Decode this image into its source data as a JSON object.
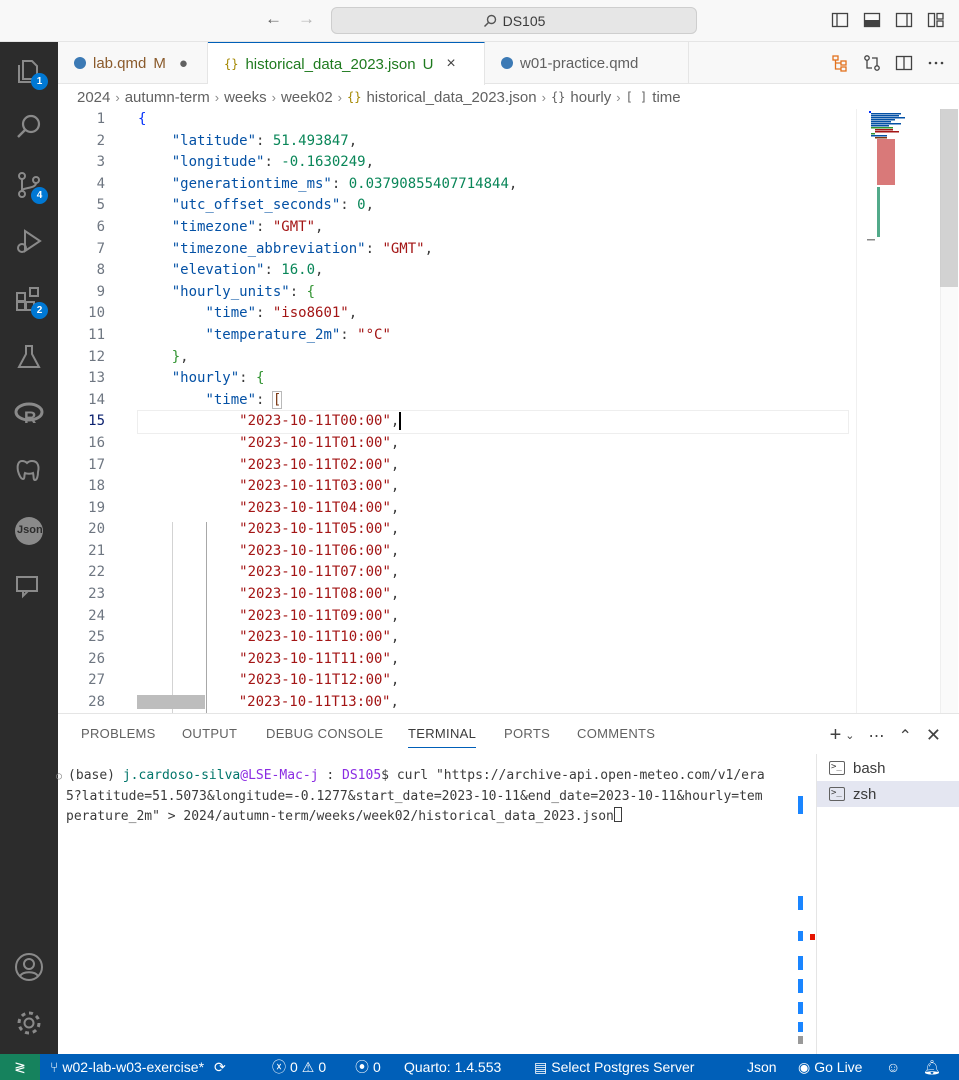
{
  "titlebar": {
    "search_label": "DS105",
    "nav_back": "←",
    "nav_forward": "→"
  },
  "activity": {
    "explorer_badge": "1",
    "scm_badge": "4",
    "extensions_badge": "2",
    "json_label": "Json"
  },
  "tabs": [
    {
      "label": "lab.qmd",
      "status": "M",
      "dirty": "●"
    },
    {
      "label": "historical_data_2023.json",
      "status": "U",
      "close": "×",
      "icon": "{}"
    },
    {
      "label": "w01-practice.qmd"
    }
  ],
  "breadcrumb": [
    "2024",
    "autumn-term",
    "weeks",
    "week02",
    "historical_data_2023.json",
    "hourly",
    "time"
  ],
  "breadcrumb_icons": {
    "file": "{}",
    "object": "{}",
    "array": "[ ]"
  },
  "editor": {
    "line_numbers": [
      "1",
      "2",
      "3",
      "4",
      "5",
      "6",
      "7",
      "8",
      "9",
      "10",
      "11",
      "12",
      "13",
      "14",
      "15",
      "16",
      "17",
      "18",
      "19",
      "20",
      "21",
      "22",
      "23",
      "24",
      "25",
      "26",
      "27",
      "28"
    ],
    "current_line": "15",
    "json": {
      "latitude": "51.493847",
      "longitude": "-0.1630249",
      "generationtime_ms": "0.03790855407714844",
      "utc_offset_seconds": "0",
      "timezone": "\"GMT\"",
      "timezone_abbreviation": "\"GMT\"",
      "elevation": "16.0",
      "time_unit": "\"iso8601\"",
      "temperature_unit": "\"°C\""
    },
    "keys": {
      "latitude": "\"latitude\"",
      "longitude": "\"longitude\"",
      "generationtime_ms": "\"generationtime_ms\"",
      "utc_offset_seconds": "\"utc_offset_seconds\"",
      "timezone": "\"timezone\"",
      "timezone_abbreviation": "\"timezone_abbreviation\"",
      "elevation": "\"elevation\"",
      "hourly_units": "\"hourly_units\"",
      "time": "\"time\"",
      "temperature_2m": "\"temperature_2m\"",
      "hourly": "\"hourly\""
    },
    "times": [
      "\"2023-10-11T00:00\"",
      "\"2023-10-11T01:00\"",
      "\"2023-10-11T02:00\"",
      "\"2023-10-11T03:00\"",
      "\"2023-10-11T04:00\"",
      "\"2023-10-11T05:00\"",
      "\"2023-10-11T06:00\"",
      "\"2023-10-11T07:00\"",
      "\"2023-10-11T08:00\"",
      "\"2023-10-11T09:00\"",
      "\"2023-10-11T10:00\"",
      "\"2023-10-11T11:00\"",
      "\"2023-10-11T12:00\"",
      "\"2023-10-11T13:00\""
    ]
  },
  "panel": {
    "tabs": [
      "PROBLEMS",
      "OUTPUT",
      "DEBUG CONSOLE",
      "TERMINAL",
      "PORTS",
      "COMMENTS"
    ],
    "active_tab": "TERMINAL",
    "terminal": {
      "env": "(base) ",
      "user": "j.cardoso-silva",
      "host": "@LSE-Mac-j",
      "sep": " : ",
      "dir": "DS105",
      "prompt": "$ ",
      "line1_cmd": "curl \"https://archive-api.open-meteo.com/v1/era",
      "line2": "5?latitude=51.5073&longitude=-0.1277&start_date=2023-10-11&end_date=2023-10-11&hourly=tem",
      "line3": "perature_2m\" > 2024/autumn-term/weeks/week02/historical_data_2023.json"
    },
    "terminal_list": [
      "bash",
      "zsh"
    ],
    "selected_terminal": "zsh"
  },
  "statusbar": {
    "branch": "w02-lab-w03-exercise*",
    "errors": "0",
    "warnings": "0",
    "ports": "0",
    "quarto": "Quarto: 1.4.553",
    "postgres": "Select Postgres Server",
    "language": "Json",
    "golive": "Go Live"
  },
  "colors": {
    "accent": "#005fb8",
    "remote": "#16825d",
    "json_key": "#0451a5",
    "json_string": "#a31515",
    "json_number": "#098658"
  }
}
